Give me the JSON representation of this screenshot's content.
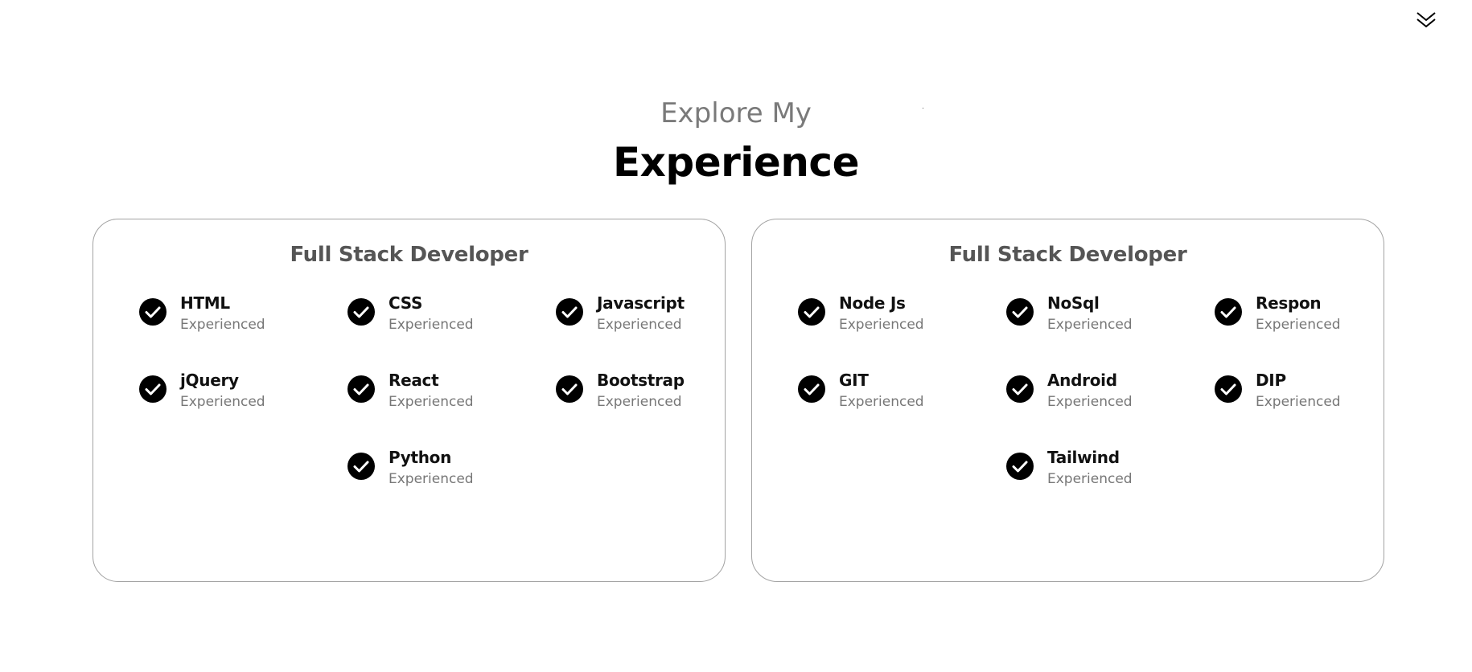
{
  "header": {
    "subtitle": "Explore My",
    "title": "Experience"
  },
  "nav": {
    "scroll_icon": "double-chevron-down-icon"
  },
  "cards": [
    {
      "title": "Full Stack Developer",
      "skills": [
        {
          "name": "HTML",
          "level": "Experienced",
          "icon": "check-circle-icon"
        },
        {
          "name": "CSS",
          "level": "Experienced",
          "icon": "check-circle-icon"
        },
        {
          "name": "Javascript",
          "level": "Experienced",
          "icon": "check-circle-icon"
        },
        {
          "name": "jQuery",
          "level": "Experienced",
          "icon": "check-circle-icon"
        },
        {
          "name": "React",
          "level": "Experienced",
          "icon": "check-circle-icon"
        },
        {
          "name": "Bootstrap",
          "level": "Experienced",
          "icon": "check-circle-icon"
        },
        {
          "name": "Python",
          "level": "Experienced",
          "icon": "check-circle-icon"
        }
      ]
    },
    {
      "title": "Full Stack Developer",
      "skills": [
        {
          "name": "Node Js",
          "level": "Experienced",
          "icon": "check-circle-icon"
        },
        {
          "name": "NoSql",
          "level": "Experienced",
          "icon": "check-circle-icon"
        },
        {
          "name": "Respon",
          "level": "Experienced",
          "icon": "check-circle-icon"
        },
        {
          "name": "GIT",
          "level": "Experienced",
          "icon": "check-circle-icon"
        },
        {
          "name": "Android",
          "level": "Experienced",
          "icon": "check-circle-icon"
        },
        {
          "name": "DIP",
          "level": "Experienced",
          "icon": "check-circle-icon"
        },
        {
          "name": "Tailwind",
          "level": "Experienced",
          "icon": "check-circle-icon"
        }
      ]
    }
  ],
  "colors": {
    "subtitle": "#7a7a7a",
    "card_title": "#555555",
    "skill_level": "#777777",
    "card_border": "#a3a3a3",
    "check_fill": "#000000"
  }
}
